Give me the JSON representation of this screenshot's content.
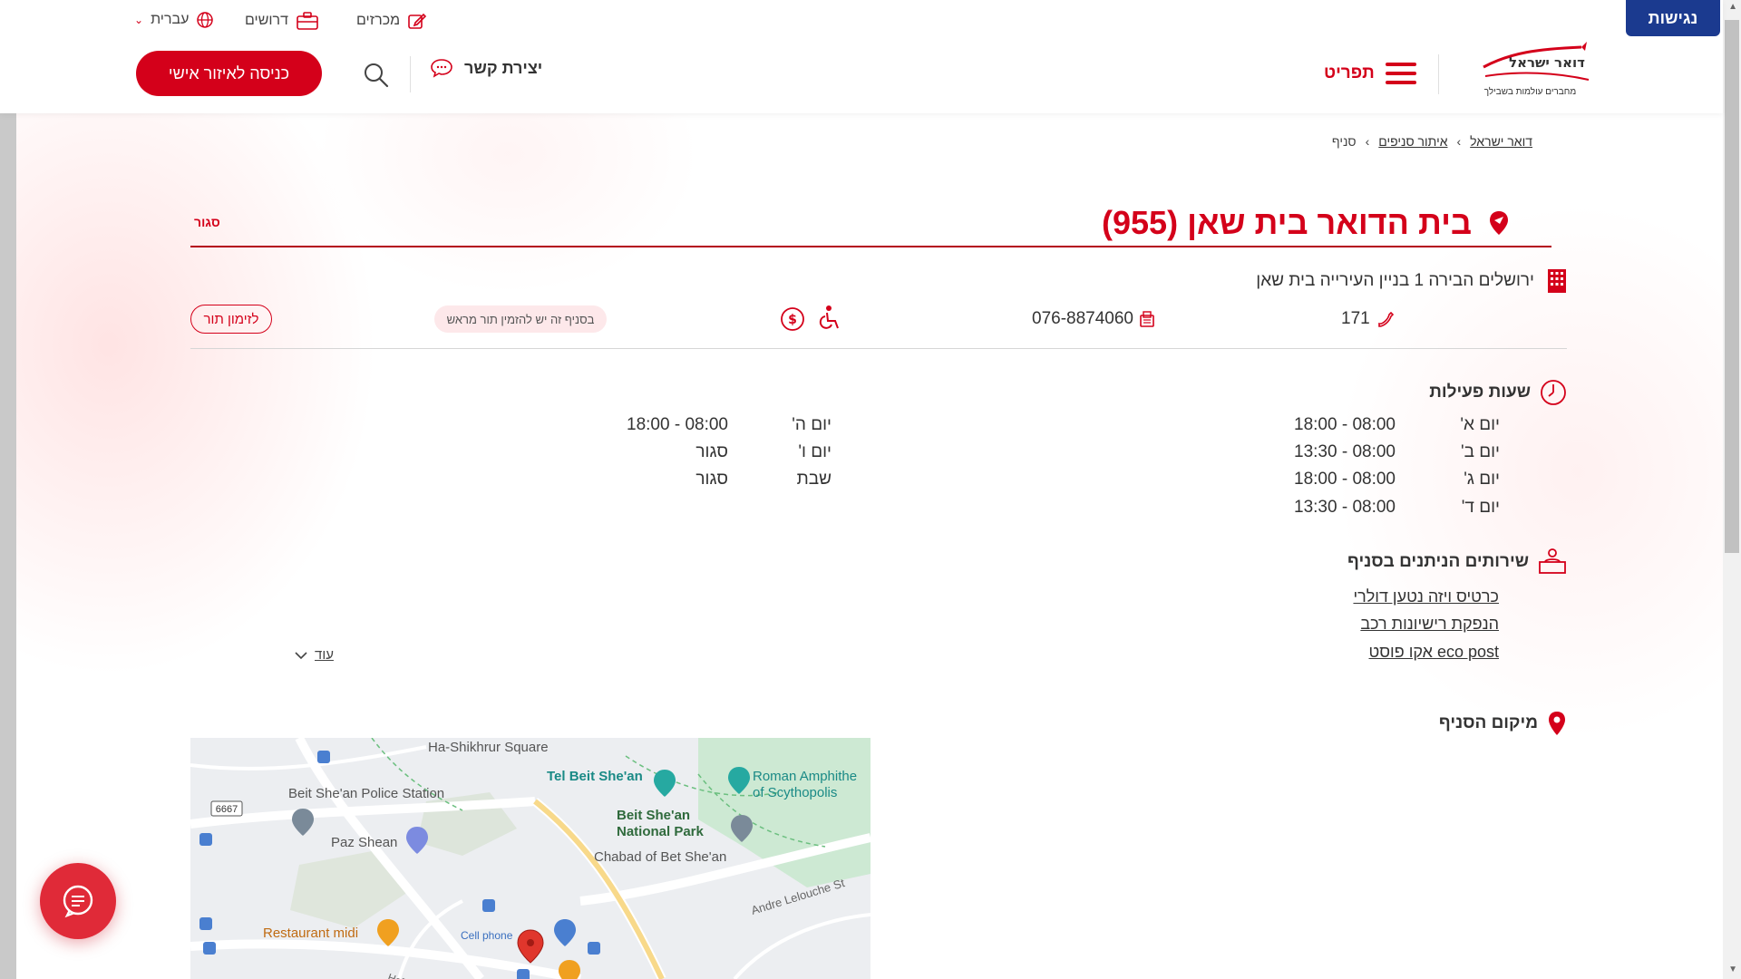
{
  "header": {
    "accessibility_label": "נגישות",
    "logo_line1": "דואר ישראל",
    "logo_tagline": "מחברים עולמות בשבילך",
    "menu_label": "תפריט",
    "login_label": "כניסה לאיזור אישי",
    "contact_label": "יצירת קשר",
    "top_links": {
      "tenders": "מכרזים",
      "jobs": "דרושים",
      "language": "עברית"
    }
  },
  "breadcrumb": {
    "home": "דואר ישראל",
    "locator": "איתור סניפים",
    "current": "סניף"
  },
  "branch": {
    "title": "בית הדואר בית שאן (955)",
    "status": "סגור",
    "address": "ירושלים הבירה 1 בניין העירייה בית שאן",
    "phone": "171",
    "fax": "076-8874060",
    "appointment_note": "בסניף זה יש להזמין תור מראש",
    "appointment_button": "לזימון תור"
  },
  "hours": {
    "title": "שעות פעילות",
    "right_column": [
      {
        "day": "יום א'",
        "time": "08:00 - 18:00"
      },
      {
        "day": "יום ב'",
        "time": "08:00 - 13:30"
      },
      {
        "day": "יום ג'",
        "time": "08:00 - 18:00"
      },
      {
        "day": "יום ד'",
        "time": "08:00 - 13:30"
      }
    ],
    "left_column": [
      {
        "day": "יום ה'",
        "time": "08:00 - 18:00"
      },
      {
        "day": "יום ו'",
        "time": "סגור"
      },
      {
        "day": "שבת",
        "time": "סגור"
      }
    ]
  },
  "services": {
    "title": "שירותים הניתנים בסניף",
    "items": [
      "כרטיס ויזה נטען דולרי",
      "הנפקת רישיונות רכב",
      "eco post אקו פוסט"
    ],
    "more_label": "עוד"
  },
  "location": {
    "title": "מיקום הסניף",
    "map_labels": {
      "square": "Ha-Shikhrur Square",
      "tel": "Tel Beit She'an",
      "amphi1": "Roman Amphithe",
      "amphi2": "of Scythopolis",
      "police": "Beit She'an Police Station",
      "park1": "Beit She'an",
      "park2": "National Park",
      "paz": "Paz Shean",
      "chabad": "Chabad of Bet She'an",
      "andre": "Andre Lelouche St",
      "restaurant": "Restaurant midi",
      "cell": "Cell phone",
      "road": "6667",
      "hat": "HaTa"
    }
  },
  "colors": {
    "brand_red": "#d4001a",
    "access_blue": "#1b3a8f"
  }
}
